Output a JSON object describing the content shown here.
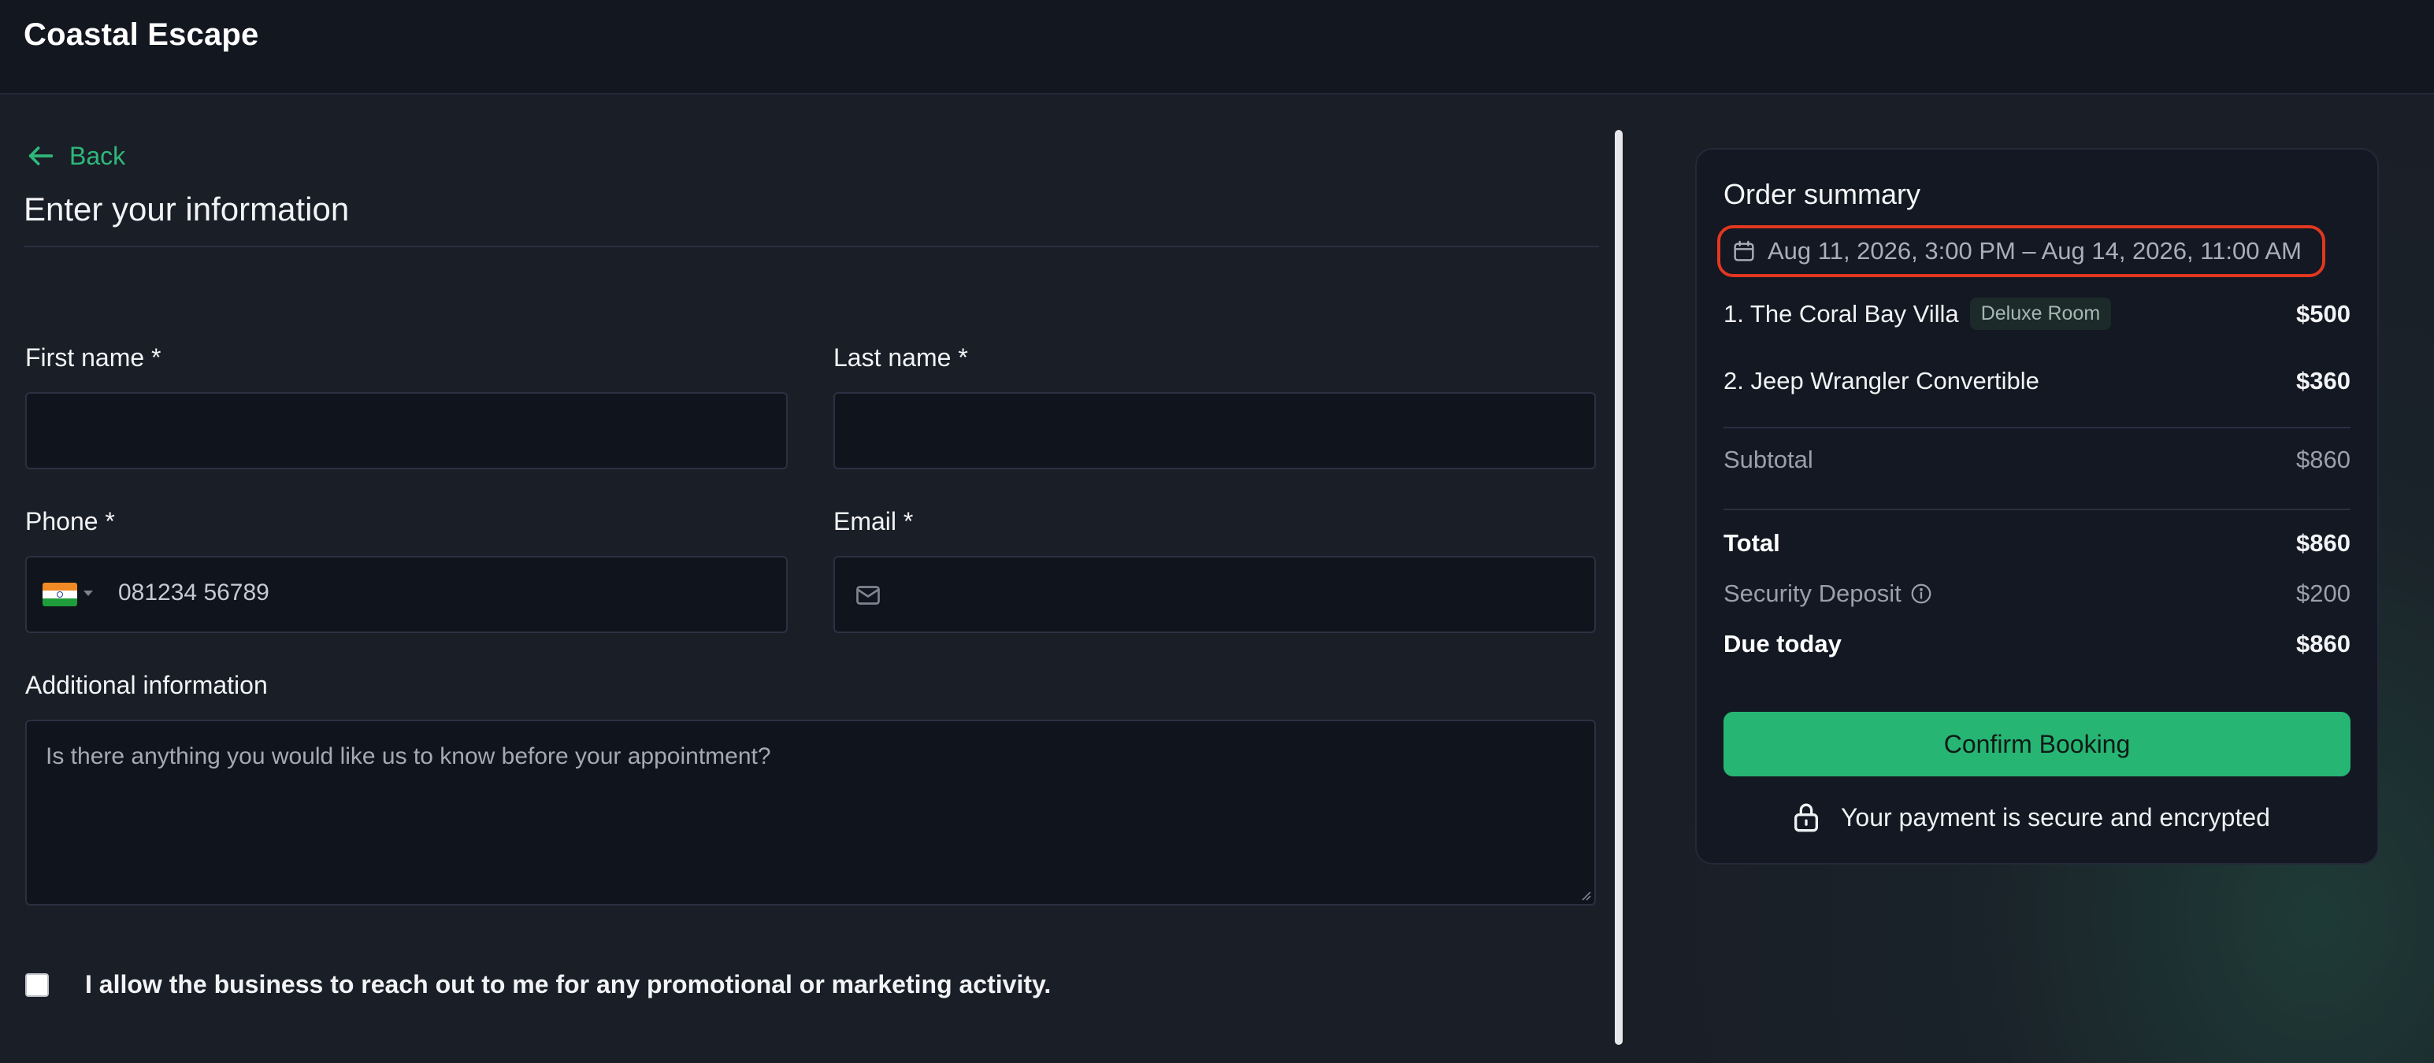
{
  "header": {
    "brand": "Coastal Escape"
  },
  "form": {
    "back_label": "Back",
    "title": "Enter your information",
    "first_name": {
      "label": "First name *",
      "value": ""
    },
    "last_name": {
      "label": "Last name *",
      "value": ""
    },
    "phone": {
      "label": "Phone *",
      "country": "India",
      "value": "081234 56789"
    },
    "email": {
      "label": "Email *",
      "value": ""
    },
    "additional": {
      "label": "Additional information",
      "placeholder": "Is there anything you would like us to know before your appointment?"
    },
    "consent": {
      "label": "I allow the business to reach out to me for any promotional or marketing activity.",
      "checked": false
    }
  },
  "summary": {
    "title": "Order summary",
    "date_range": "Aug 11, 2026, 3:00 PM – Aug 14, 2026, 11:00 AM",
    "items": [
      {
        "name": "1. The Coral Bay Villa",
        "badge": "Deluxe Room",
        "price": "$500"
      },
      {
        "name": "2. Jeep Wrangler Convertible",
        "badge": "",
        "price": "$360"
      }
    ],
    "subtotal": {
      "label": "Subtotal",
      "value": "$860"
    },
    "total": {
      "label": "Total",
      "value": "$860"
    },
    "deposit": {
      "label": "Security Deposit",
      "value": "$200"
    },
    "due_today": {
      "label": "Due today",
      "value": "$860"
    },
    "confirm_label": "Confirm Booking",
    "secure_note": "Your payment is secure and encrypted"
  },
  "colors": {
    "accent": "#27b574",
    "highlight_ring": "#e2371f",
    "background": "#1a1e27"
  }
}
